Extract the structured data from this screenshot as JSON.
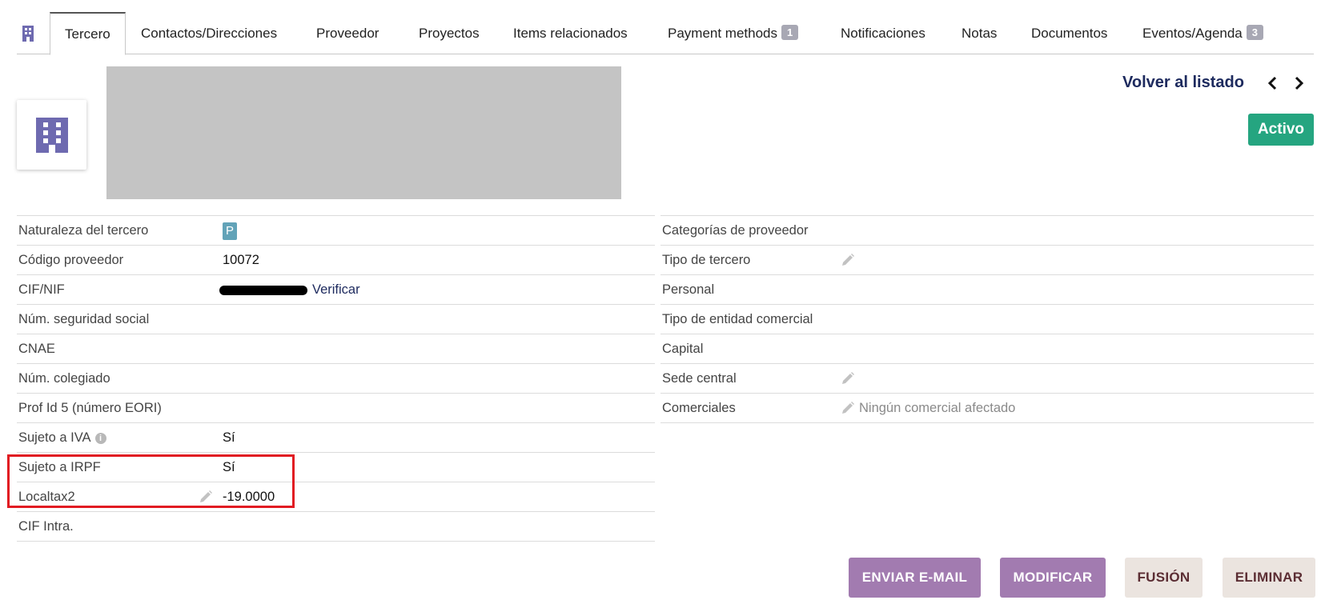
{
  "tabs": [
    {
      "label": "Tercero",
      "active": true
    },
    {
      "label": "Contactos/Direcciones"
    },
    {
      "label": "Proveedor"
    },
    {
      "label": "Proyectos"
    },
    {
      "label": "Items relacionados"
    },
    {
      "label": "Payment methods",
      "badge": "1"
    },
    {
      "label": "Notificaciones"
    },
    {
      "label": "Notas"
    },
    {
      "label": "Documentos"
    },
    {
      "label": "Eventos/Agenda",
      "badge": "3"
    }
  ],
  "header": {
    "back_label": "Volver al listado",
    "status": "Activo",
    "status_color": "#25a580",
    "logo_icon": "building-icon"
  },
  "left_fields": [
    {
      "label": "Naturaleza del tercero",
      "tag": "P"
    },
    {
      "label": "Código proveedor",
      "value": "10072"
    },
    {
      "label": "CIF/NIF",
      "link": "Verificar"
    },
    {
      "label": "Núm. seguridad social",
      "value": ""
    },
    {
      "label": "CNAE",
      "value": ""
    },
    {
      "label": "Núm. colegiado",
      "value": ""
    },
    {
      "label": "Prof Id 5 (número EORI)",
      "value": ""
    },
    {
      "label": "Sujeto a IVA",
      "value": "Sí"
    },
    {
      "label": "Sujeto a IRPF",
      "value": "Sí"
    },
    {
      "label": "Localtax2",
      "value": "-19.0000"
    },
    {
      "label": "CIF Intra.",
      "value": ""
    }
  ],
  "right_fields": [
    {
      "label": "Categorías de proveedor",
      "value": ""
    },
    {
      "label": "Tipo de tercero",
      "value": ""
    },
    {
      "label": "Personal",
      "value": ""
    },
    {
      "label": "Tipo de entidad comercial",
      "value": ""
    },
    {
      "label": "Capital",
      "value": ""
    },
    {
      "label": "Sede central",
      "value": ""
    },
    {
      "label": "Comerciales",
      "value": "Ningún comercial afectado"
    }
  ],
  "actions": {
    "email": "ENVIAR E-MAIL",
    "modify": "MODIFICAR",
    "merge": "FUSIÓN",
    "delete": "ELIMINAR"
  },
  "colors": {
    "primary_button": "#a27bb0",
    "secondary_button": "#ebe4df",
    "highlight_border": "#e11b22",
    "link": "#1d2a5e"
  }
}
